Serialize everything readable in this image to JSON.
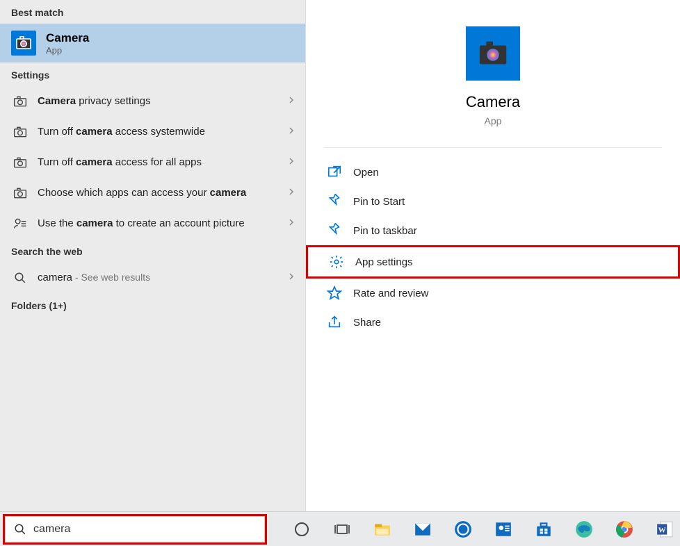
{
  "left": {
    "best_match_header": "Best match",
    "best_match": {
      "title": "Camera",
      "subtitle": "App"
    },
    "settings_header": "Settings",
    "settings_items": [
      {
        "pre": "",
        "bold": "Camera",
        "post": " privacy settings"
      },
      {
        "pre": "Turn off ",
        "bold": "camera",
        "post": " access systemwide"
      },
      {
        "pre": "Turn off ",
        "bold": "camera",
        "post": " access for all apps"
      },
      {
        "pre": "Choose which apps can access your ",
        "bold": "camera",
        "post": ""
      },
      {
        "pre": "Use the ",
        "bold": "camera",
        "post": " to create an account picture"
      }
    ],
    "web_header": "Search the web",
    "web_item": {
      "term": "camera",
      "suffix": " - See web results"
    },
    "folders_header": "Folders (1+)"
  },
  "right": {
    "title": "Camera",
    "subtitle": "App",
    "actions": [
      {
        "label": "Open"
      },
      {
        "label": "Pin to Start"
      },
      {
        "label": "Pin to taskbar"
      },
      {
        "label": "App settings",
        "highlight": true
      },
      {
        "label": "Rate and review"
      },
      {
        "label": "Share"
      }
    ]
  },
  "taskbar": {
    "search_value": "camera"
  }
}
